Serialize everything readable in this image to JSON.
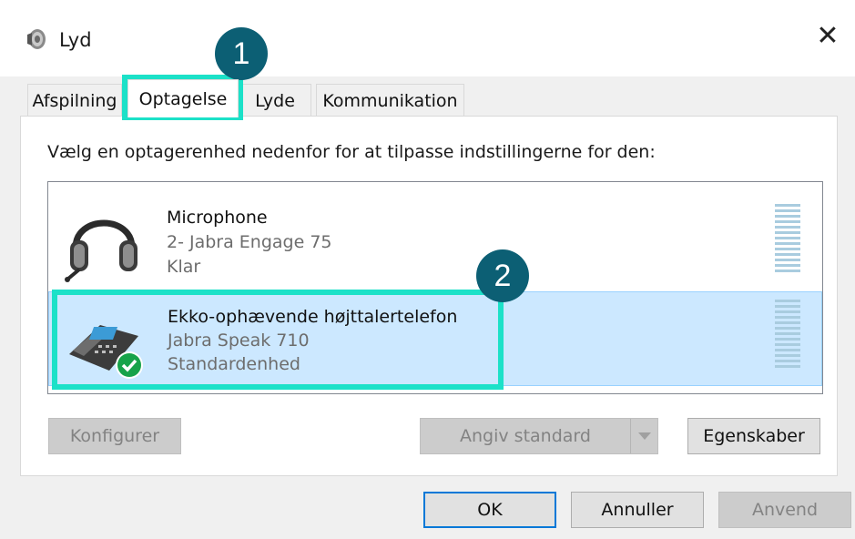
{
  "window": {
    "title": "Lyd",
    "close_glyph": "✕"
  },
  "tabs": [
    {
      "label": "Afspilning",
      "active": false
    },
    {
      "label": "Optagelse",
      "active": true
    },
    {
      "label": "Lyde",
      "active": false
    },
    {
      "label": "Kommunikation",
      "active": false
    }
  ],
  "instruction": "Vælg en optagerenhed nedenfor for at tilpasse indstillingerne for den:",
  "devices": [
    {
      "name": "Microphone",
      "model": "2- Jabra Engage 75",
      "status": "Klar",
      "selected": false,
      "icon": "headset-icon"
    },
    {
      "name": "Ekko-ophævende højttalertelefon",
      "model": "Jabra Speak 710",
      "status": "Standardenhed",
      "selected": true,
      "icon": "speakerphone-icon"
    }
  ],
  "buttons": {
    "configure": "Konfigurer",
    "set_default": "Angiv standard",
    "properties": "Egenskaber",
    "ok": "OK",
    "cancel": "Annuller",
    "apply": "Anvend"
  },
  "callouts": [
    "1",
    "2"
  ],
  "colors": {
    "highlight": "#1ce1c8",
    "callout_badge": "#0c5f74",
    "selection_bg": "#cce8ff",
    "default_button_border": "#0078d7"
  }
}
